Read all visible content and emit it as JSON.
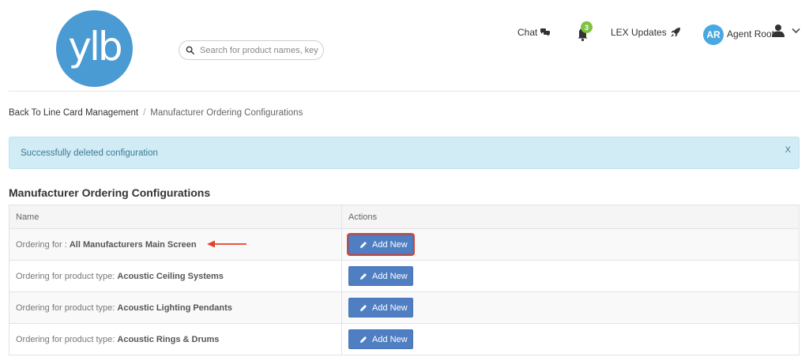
{
  "header": {
    "logo_text": "ylb",
    "search_placeholder": "Search for product names, keywords",
    "chat_label": "Chat",
    "notification_count": "3",
    "lex_label": "LEX Updates",
    "avatar_initials": "AR",
    "user_name": "Agent Root"
  },
  "breadcrumb": {
    "back_link": "Back To Line Card Management",
    "separator": "/",
    "current": "Manufacturer Ordering Configurations"
  },
  "alert": {
    "message": "Successfully deleted configuration",
    "close_label": "X"
  },
  "section_title": "Manufacturer Ordering Configurations",
  "table": {
    "columns": [
      "Name",
      "Actions"
    ],
    "rows": [
      {
        "prefix": "Ordering for : ",
        "name": "All Manufacturers Main Screen",
        "action": "Add New"
      },
      {
        "prefix": "Ordering for product type: ",
        "name": "Acoustic Ceiling Systems",
        "action": "Add New"
      },
      {
        "prefix": "Ordering for product type: ",
        "name": "Acoustic Lighting Pendants",
        "action": "Add New"
      },
      {
        "prefix": "Ordering for product type: ",
        "name": "Acoustic Rings & Drums",
        "action": "Add New"
      }
    ]
  },
  "colors": {
    "brand_blue": "#4a9ad4",
    "button_blue": "#4f7fc2",
    "highlight_red": "#e0432c",
    "alert_bg": "#d1ecf5",
    "badge_green": "#7fc241"
  },
  "icons": [
    "search-icon",
    "chat-icon",
    "bell-icon",
    "rocket-icon",
    "user-icon",
    "chevron-down-icon",
    "pencil-icon",
    "arrow-left-icon"
  ]
}
